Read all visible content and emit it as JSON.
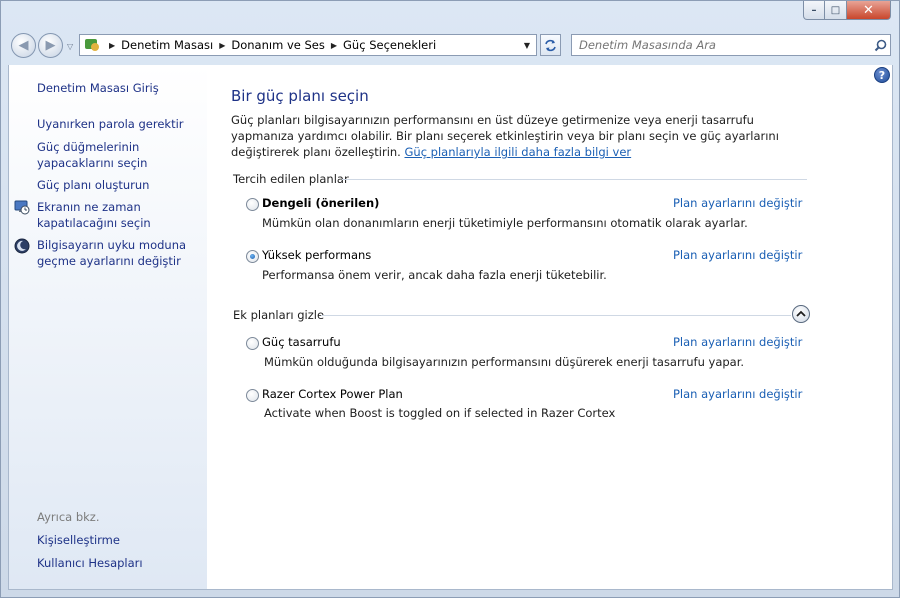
{
  "window": {
    "caption_buttons": {
      "minimize": "–",
      "maximize": "□",
      "close": "✕"
    }
  },
  "nav": {
    "back": "◀",
    "forward": "▶",
    "breadcrumbs": [
      "Denetim Masası",
      "Donanım ve Ses",
      "Güç Seçenekleri"
    ],
    "search_placeholder": "Denetim Masasında Ara"
  },
  "sidebar": {
    "home": "Denetim Masası Giriş",
    "links": [
      {
        "label": "Uyanırken parola gerektir"
      },
      {
        "label": "Güç düğmelerinin yapacaklarını seçin"
      },
      {
        "label": "Güç planı oluşturun"
      },
      {
        "label": "Ekranın ne zaman kapatılacağını seçin",
        "icon": "monitor-clock-icon"
      },
      {
        "label": "Bilgisayarın uyku moduna geçme ayarlarını değiştir",
        "icon": "moon-icon"
      }
    ],
    "see_also": "Ayrıca bkz.",
    "see_also_links": [
      "Kişiselleştirme",
      "Kullanıcı Hesapları"
    ]
  },
  "main": {
    "help": "?",
    "title": "Bir güç planı seçin",
    "description": "Güç planları bilgisayarınızın performansını en üst düzeye getirmenize veya enerji tasarrufu yapmanıza yardımcı olabilir. Bir planı seçerek etkinleştirin veya bir planı seçin ve güç ayarlarını değiştirerek planı özelleştirin.",
    "more_info_link": "Güç planlarıyla ilgili daha fazla bilgi ver",
    "preferred_header": "Tercih edilen planlar",
    "extra_header": "Ek planları gizle",
    "change_link": "Plan ayarlarını değiştir",
    "preferred_plans": [
      {
        "name": "Dengeli (önerilen)",
        "desc": "Mümkün olan donanımların enerji tüketimiyle performansını otomatik olarak ayarlar.",
        "selected": false,
        "bold": true
      },
      {
        "name": "Yüksek performans",
        "desc": "Performansa önem verir, ancak daha fazla enerji tüketebilir.",
        "selected": true,
        "bold": false
      }
    ],
    "extra_plans": [
      {
        "name": "Güç tasarrufu",
        "desc": "Mümkün olduğunda bilgisayarınızın performansını düşürerek enerji tasarrufu yapar.",
        "selected": false
      },
      {
        "name": "Razer Cortex Power Plan",
        "desc": "Activate when Boost is toggled on if selected in Razer Cortex",
        "selected": false
      }
    ]
  }
}
